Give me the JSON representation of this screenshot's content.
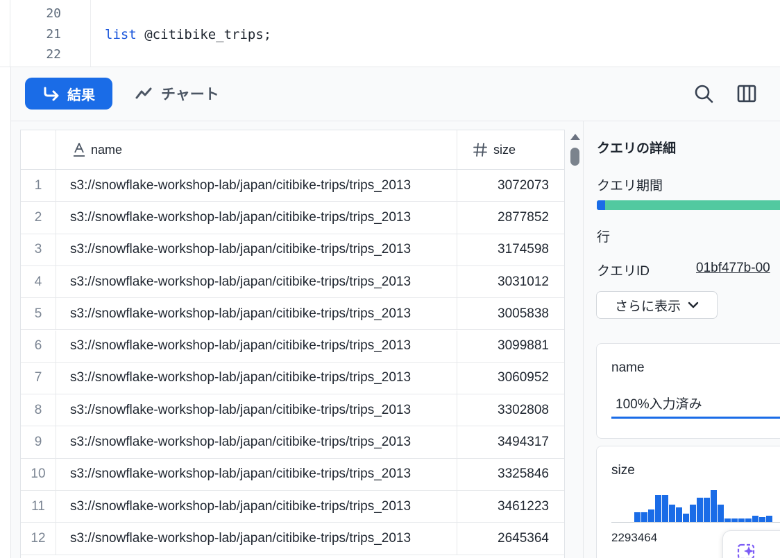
{
  "editor": {
    "lines": [
      {
        "number": "20",
        "keyword": "",
        "text": ""
      },
      {
        "number": "21",
        "keyword": "list",
        "text": " @citibike_trips;"
      },
      {
        "number": "22",
        "keyword": "",
        "text": ""
      }
    ]
  },
  "toolbar": {
    "results_label": "結果",
    "chart_label": "チャート",
    "accent": "#1a6ce7"
  },
  "table": {
    "columns": [
      {
        "name": "name",
        "type_icon": "text-type-icon"
      },
      {
        "name": "size",
        "type_icon": "number-type-icon"
      }
    ],
    "rows": [
      {
        "index": "1",
        "name": "s3://snowflake-workshop-lab/japan/citibike-trips/trips_2013",
        "size": "3072073"
      },
      {
        "index": "2",
        "name": "s3://snowflake-workshop-lab/japan/citibike-trips/trips_2013",
        "size": "2877852"
      },
      {
        "index": "3",
        "name": "s3://snowflake-workshop-lab/japan/citibike-trips/trips_2013",
        "size": "3174598"
      },
      {
        "index": "4",
        "name": "s3://snowflake-workshop-lab/japan/citibike-trips/trips_2013",
        "size": "3031012"
      },
      {
        "index": "5",
        "name": "s3://snowflake-workshop-lab/japan/citibike-trips/trips_2013",
        "size": "3005838"
      },
      {
        "index": "6",
        "name": "s3://snowflake-workshop-lab/japan/citibike-trips/trips_2013",
        "size": "3099881"
      },
      {
        "index": "7",
        "name": "s3://snowflake-workshop-lab/japan/citibike-trips/trips_2013",
        "size": "3060952"
      },
      {
        "index": "8",
        "name": "s3://snowflake-workshop-lab/japan/citibike-trips/trips_2013",
        "size": "3302808"
      },
      {
        "index": "9",
        "name": "s3://snowflake-workshop-lab/japan/citibike-trips/trips_2013",
        "size": "3494317"
      },
      {
        "index": "10",
        "name": "s3://snowflake-workshop-lab/japan/citibike-trips/trips_2013",
        "size": "3325846"
      },
      {
        "index": "11",
        "name": "s3://snowflake-workshop-lab/japan/citibike-trips/trips_2013",
        "size": "3461223"
      },
      {
        "index": "12",
        "name": "s3://snowflake-workshop-lab/japan/citibike-trips/trips_2013",
        "size": "2645364"
      }
    ]
  },
  "details": {
    "title": "クエリの詳細",
    "duration_label": "クエリ期間",
    "rows_label": "行",
    "query_id_label": "クエリID",
    "query_id_value": "01bf477b-00",
    "show_more_label": "さらに表示",
    "name_card": {
      "label": "name",
      "fill_text": "100%入力済み"
    },
    "size_card": {
      "label": "size",
      "min_value": "2293464",
      "histogram_levels": [
        0.3,
        0.3,
        0.4,
        0.85,
        0.85,
        0.55,
        0.45,
        0.25,
        0.55,
        0.75,
        0.75,
        1.0,
        0.55,
        0.1,
        0.1,
        0.1,
        0.1,
        0.2,
        0.15,
        0.2
      ]
    },
    "colors": {
      "duration_bar": "#52c9a0",
      "duration_segment": "#1a6ce7",
      "histogram": "#1a6ce7"
    }
  }
}
